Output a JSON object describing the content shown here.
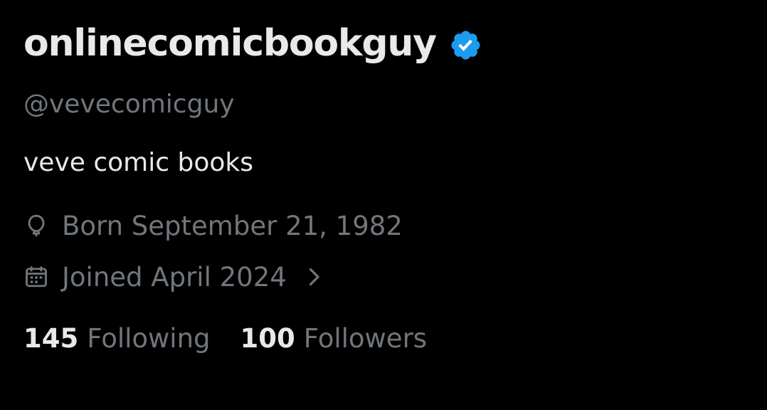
{
  "profile": {
    "display_name": "onlinecomicbookguy",
    "verified": true,
    "handle": "@vevecomicguy",
    "bio": "veve comic books",
    "birth": "Born September 21, 1982",
    "joined": "Joined April 2024",
    "following": {
      "count": "145",
      "label": "Following"
    },
    "followers": {
      "count": "100",
      "label": "Followers"
    }
  },
  "icons": {
    "verified": "verified-badge-icon",
    "birth": "balloon-icon",
    "joined": "calendar-icon",
    "chevron": "chevron-right-icon"
  },
  "colors": {
    "background": "#000000",
    "primary_text": "#e7e9ea",
    "secondary_text": "#71767b",
    "verified_blue": "#1d9bf0"
  }
}
